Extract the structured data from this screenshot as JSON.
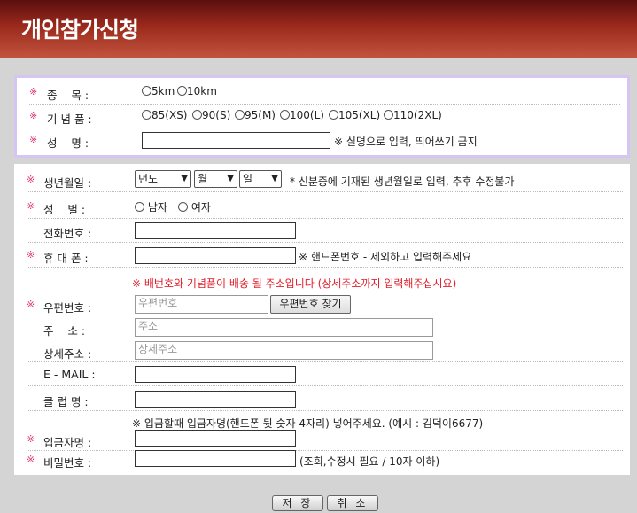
{
  "header": {
    "title": "개인참가신청"
  },
  "section1": {
    "event": {
      "mark": "※",
      "label": "종    목 :",
      "options": [
        "5km",
        "10km"
      ]
    },
    "gift": {
      "mark": "※",
      "label": "기 념 품 :",
      "options": [
        "85(XS)",
        "90(S)",
        "95(M)",
        "100(L)",
        "105(XL)",
        "110(2XL)"
      ]
    },
    "name": {
      "mark": "※",
      "label": "성    명 :",
      "note": "※ 실명으로 입력, 띄어쓰기 금지"
    }
  },
  "section2": {
    "birth": {
      "mark": "※",
      "label": "생년월일 :",
      "year": "년도",
      "month": "월",
      "day": "일",
      "note": "* 신분증에 기재된 생년월일로 입력, 추후 수정불가"
    },
    "gender": {
      "mark": "※",
      "label": "성    별 :",
      "options": [
        "남자",
        "여자"
      ]
    },
    "phone": {
      "label": "전화번호 :"
    },
    "mobile": {
      "mark": "※",
      "label": "휴 대 폰 :",
      "note": "※ 핸드폰번호 - 제외하고 입력해주세요"
    },
    "address_notice": "※ 배번호와 기념품이 배송 될 주소입니다 (상세주소까지 입력해주십시요)",
    "zip": {
      "mark": "※",
      "label": "우편번호 :",
      "placeholder": "우편번호",
      "button": "우편번호 찾기"
    },
    "addr": {
      "label": "주    소 :",
      "placeholder": "주소"
    },
    "addr_detail": {
      "label": "상세주소 :",
      "placeholder": "상세주소"
    },
    "email": {
      "label": "E - MAIL :"
    },
    "club": {
      "label": "클 럽 명 :"
    },
    "depositor_notice": "※ 입금할때 입금자명(핸드폰 뒷 숫자 4자리) 넣어주세요. (예시 : 김덕이6677)",
    "depositor": {
      "mark": "※",
      "label": "입금자명 :"
    },
    "password": {
      "mark": "※",
      "label": "비밀번호 :",
      "note": "(조회,수정시 필요 / 10자 이하)"
    }
  },
  "buttons": {
    "save": "저 장",
    "cancel": "취 소"
  }
}
